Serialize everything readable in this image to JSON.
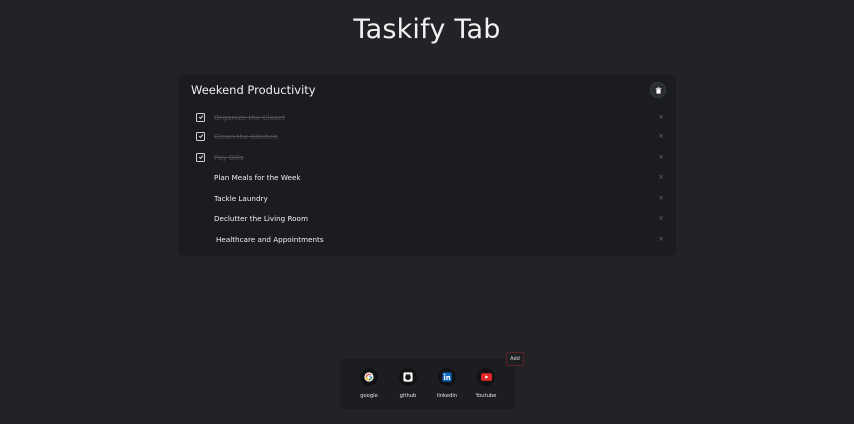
{
  "app": {
    "title": "Taskify Tab"
  },
  "list": {
    "title": "Weekend Productivity",
    "tasks": [
      {
        "label": "Organize the Closet",
        "done": true
      },
      {
        "label": "Clean the Kitchen",
        "done": true
      },
      {
        "label": "Pay Bills",
        "done": true
      },
      {
        "label": "Plan Meals for the Week",
        "done": false
      },
      {
        "label": "Tackle Laundry",
        "done": false
      },
      {
        "label": "Declutter the Living Room",
        "done": false
      },
      {
        "label": "Healthcare and Appointments",
        "done": false
      }
    ],
    "remove_symbol": "×"
  },
  "shortcuts": {
    "add_label": "Add",
    "items": [
      {
        "label": "google",
        "icon": "google-icon"
      },
      {
        "label": "github",
        "icon": "github-icon"
      },
      {
        "label": "linkedin",
        "icon": "linkedin-icon"
      },
      {
        "label": "Youtube",
        "icon": "youtube-icon"
      }
    ]
  },
  "colors": {
    "background": "#232327",
    "card": "#1b1c1f",
    "linkedin": "#0a66c2",
    "youtube": "#e02626"
  }
}
